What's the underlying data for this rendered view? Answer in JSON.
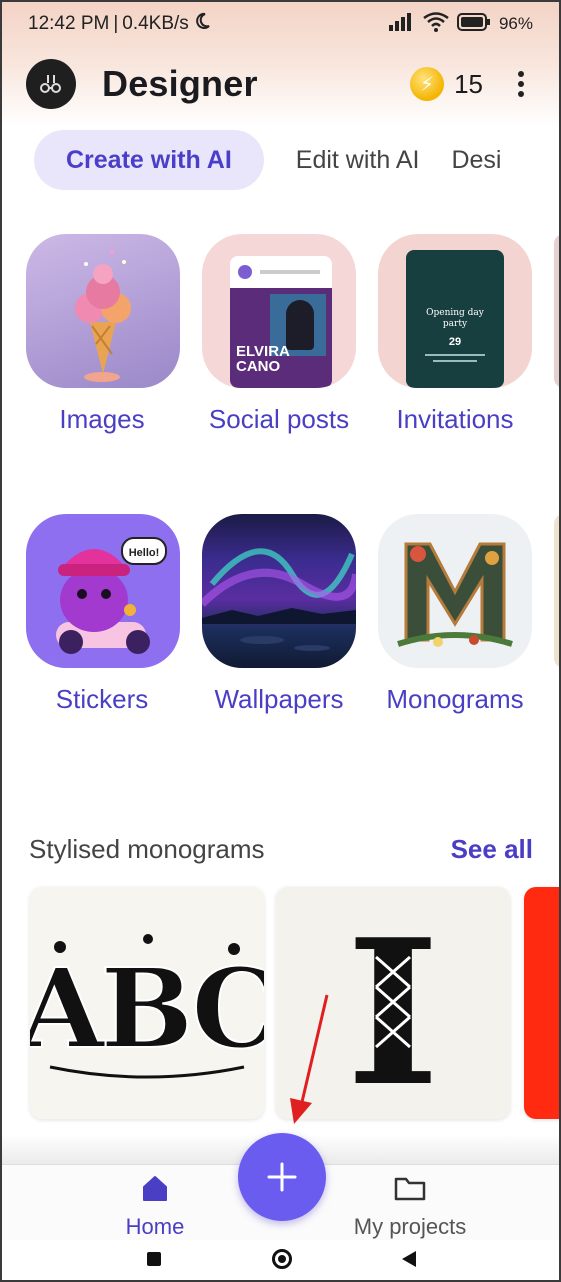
{
  "status_bar": {
    "time": "12:42 PM",
    "speed": "0.4KB/s",
    "battery": "96"
  },
  "app": {
    "title": "Designer",
    "coins": "15"
  },
  "tabs": [
    {
      "label": "Create with AI",
      "active": true
    },
    {
      "label": "Edit with AI",
      "active": false
    },
    {
      "label": "Desi",
      "active": false
    }
  ],
  "categories_row1": [
    {
      "label": "Images"
    },
    {
      "label": "Social posts"
    },
    {
      "label": "Invitations"
    }
  ],
  "categories_row2": [
    {
      "label": "Stickers"
    },
    {
      "label": "Wallpapers"
    },
    {
      "label": "Monograms"
    }
  ],
  "thumbnails": {
    "social_name": "ELVIRA\nCANO",
    "invite_title": "Opening day party",
    "invite_day": "29",
    "sticker_text": "Hello!"
  },
  "section": {
    "title": "Stylised monograms",
    "see_all": "See all"
  },
  "monogram_cards": [
    {
      "text": "ABC"
    },
    {
      "text": "I"
    }
  ],
  "bottom_nav": {
    "home": "Home",
    "projects": "My projects"
  },
  "colors": {
    "accent": "#4a3fc4",
    "fab": "#6b5cf0",
    "annotation": "#e02020"
  }
}
